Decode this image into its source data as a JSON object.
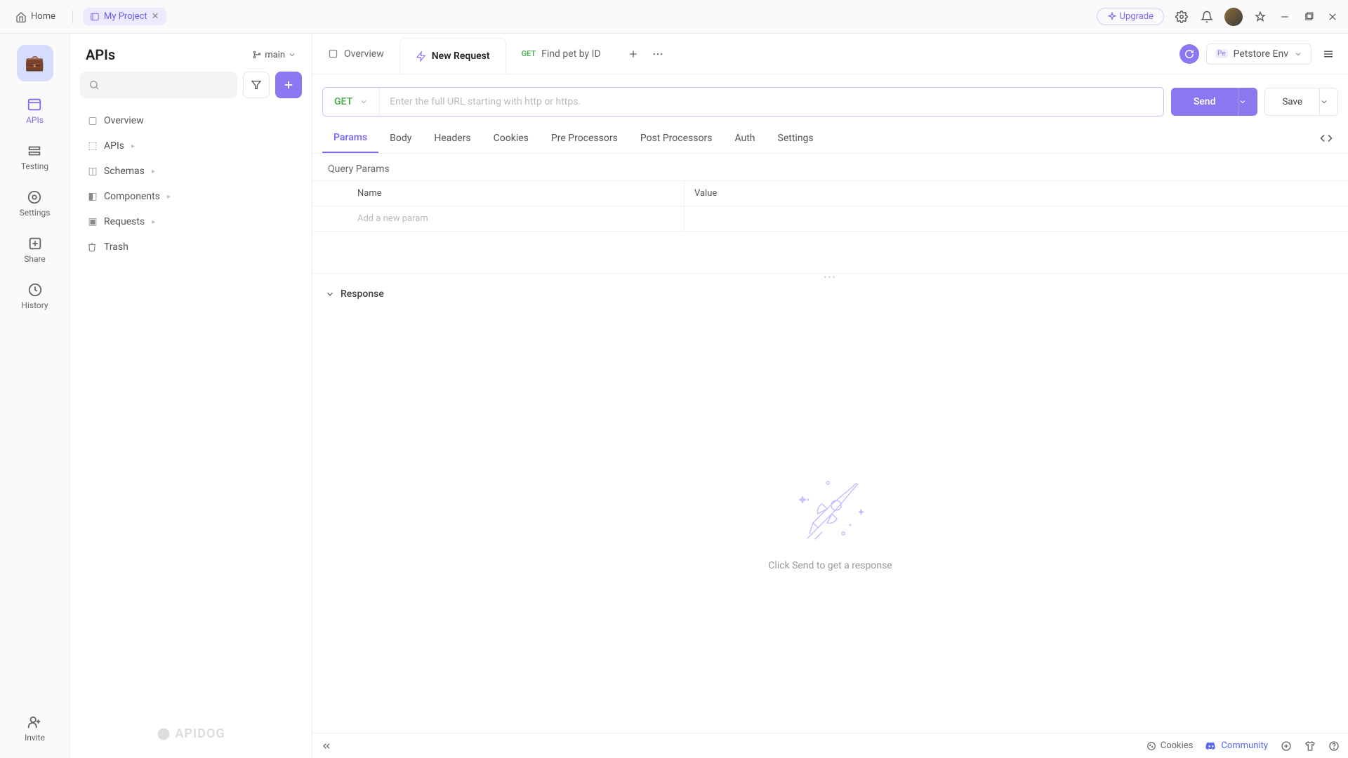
{
  "titleBar": {
    "home": "Home",
    "project": "My Project",
    "upgrade": "Upgrade"
  },
  "rail": {
    "apis": "APIs",
    "testing": "Testing",
    "settings": "Settings",
    "share": "Share",
    "history": "History",
    "invite": "Invite"
  },
  "sidebar": {
    "title": "APIs",
    "branch": "main",
    "items": {
      "overview": "Overview",
      "apis": "APIs",
      "schemas": "Schemas",
      "components": "Components",
      "requests": "Requests",
      "trash": "Trash"
    },
    "brand": "APIDOG"
  },
  "tabs": {
    "overview": "Overview",
    "newRequest": "New Request",
    "findPet": {
      "method": "GET",
      "label": "Find pet by ID"
    }
  },
  "env": {
    "badge": "Pe",
    "name": "Petstore Env"
  },
  "urlBar": {
    "method": "GET",
    "placeholder": "Enter the full URL starting with http or https.",
    "send": "Send",
    "save": "Save"
  },
  "subtabs": {
    "params": "Params",
    "body": "Body",
    "headers": "Headers",
    "cookies": "Cookies",
    "pre": "Pre Processors",
    "post": "Post Processors",
    "auth": "Auth",
    "settings": "Settings"
  },
  "paramsSection": {
    "title": "Query Params",
    "colName": "Name",
    "colValue": "Value",
    "placeholder": "Add a new param"
  },
  "response": {
    "title": "Response",
    "empty": "Click Send to get a response"
  },
  "statusBar": {
    "cookies": "Cookies",
    "community": "Community"
  }
}
